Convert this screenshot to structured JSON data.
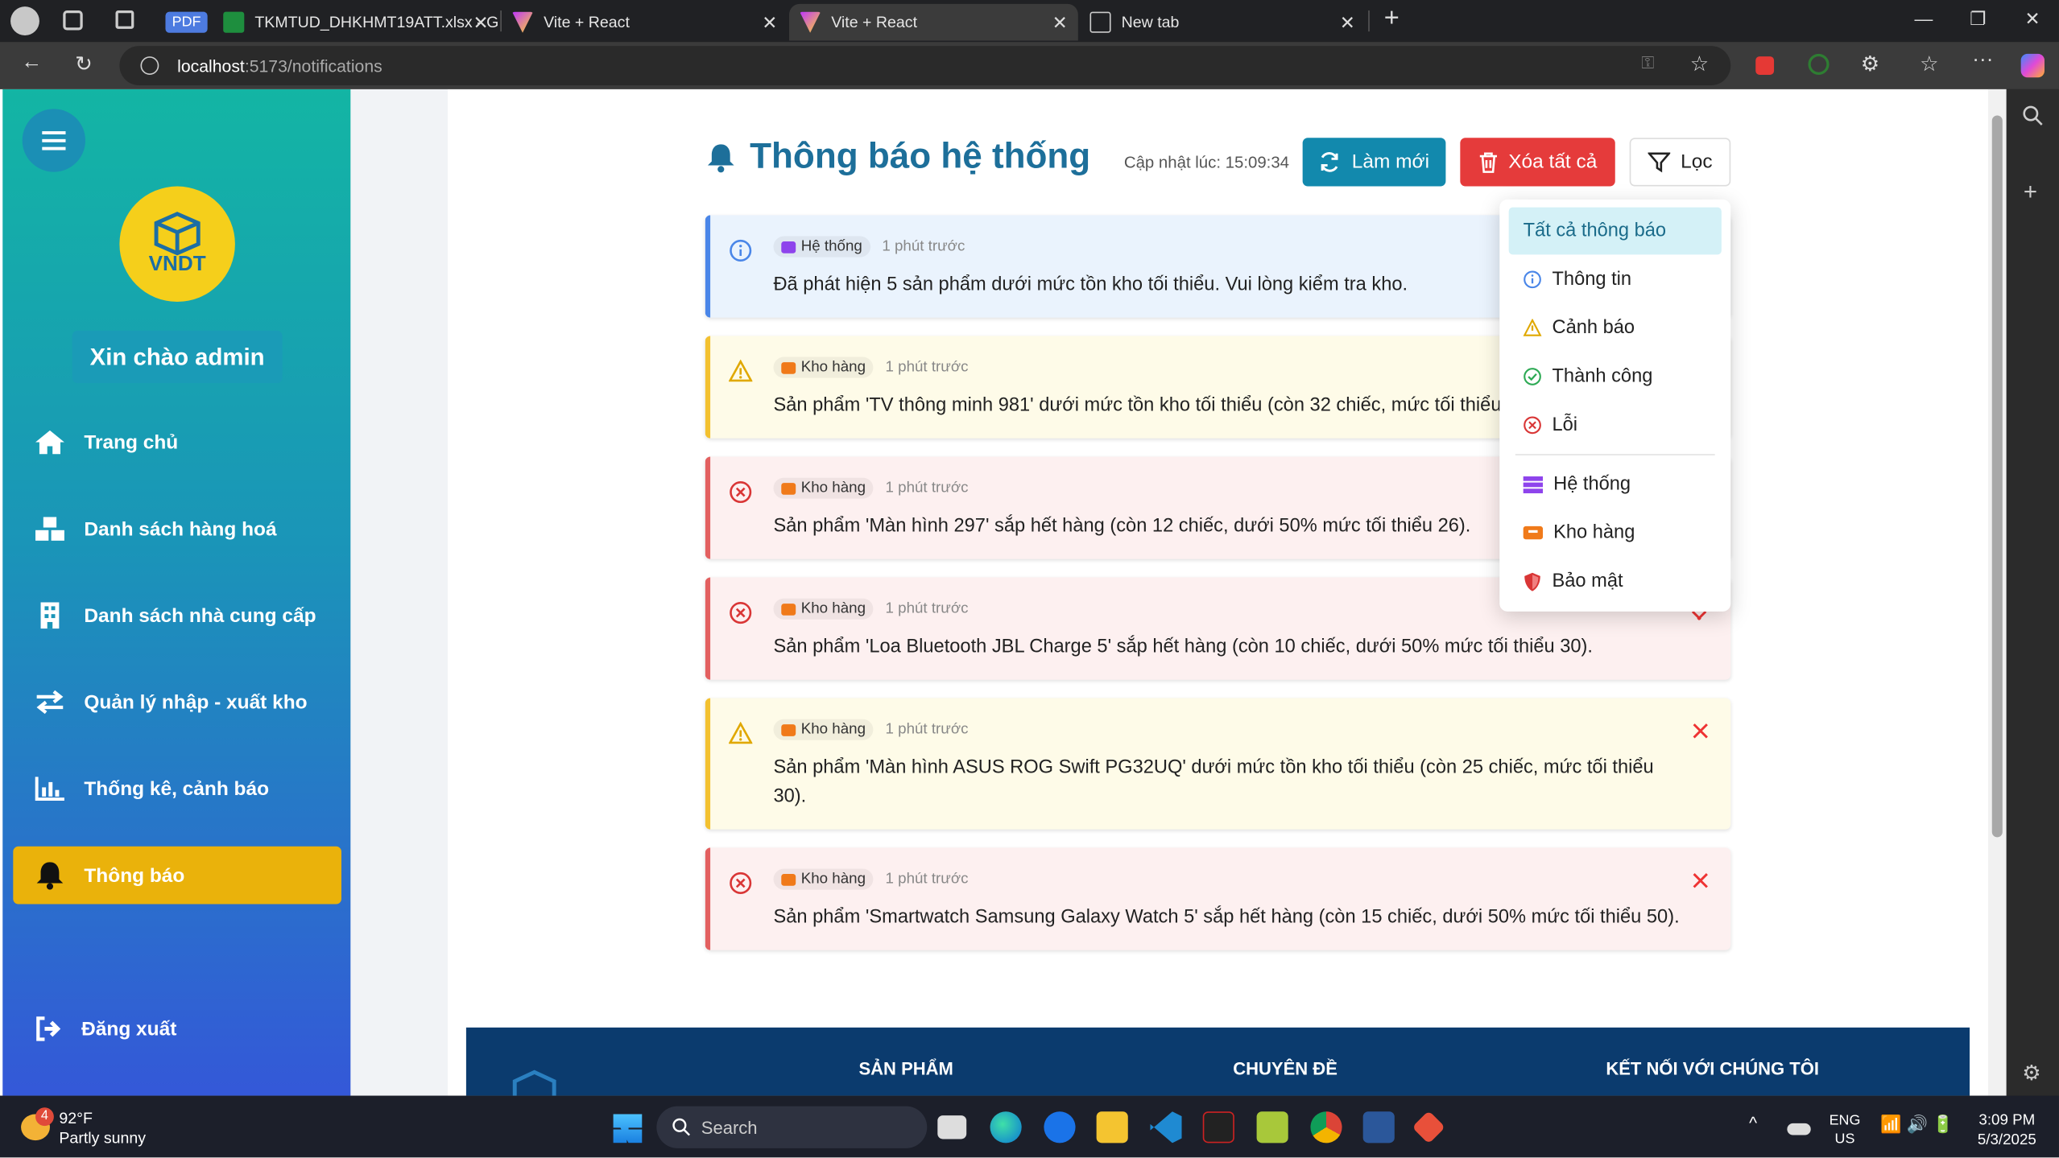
{
  "browser": {
    "tabs": [
      {
        "label": "",
        "icon": "account-icon"
      },
      {
        "label": "PDF",
        "icon": "pdf-icon"
      },
      {
        "label": "TKMTUD_DHKHMT19ATT.xlsx - G",
        "icon": "sheets-icon"
      },
      {
        "label": "Vite + React",
        "icon": "vite-icon"
      },
      {
        "label": "Vite + React",
        "icon": "vite-icon",
        "active": true
      },
      {
        "label": "New tab",
        "icon": "newtab-icon"
      }
    ],
    "url_host": "localhost",
    "url_path": ":5173/notifications"
  },
  "sidebar": {
    "logo_text": "VNDT",
    "greeting": "Xin chào  admin",
    "items": [
      {
        "label": "Trang chủ",
        "icon": "home-icon"
      },
      {
        "label": "Danh sách hàng hoá",
        "icon": "boxes-icon"
      },
      {
        "label": "Danh sách nhà cung cấp",
        "icon": "building-icon"
      },
      {
        "label": "Quản lý nhập - xuất kho",
        "icon": "arrows-icon"
      },
      {
        "label": "Thống kê, cảnh báo",
        "icon": "chart-icon"
      },
      {
        "label": "Thông báo",
        "icon": "bell-icon",
        "active": true
      }
    ],
    "logout": "Đăng xuất"
  },
  "header": {
    "title": "Thông báo hệ thống",
    "updated": "Cập nhật lúc: 15:09:34",
    "refresh": "Làm mới",
    "clear_all": "Xóa tất cả",
    "filter": "Lọc"
  },
  "notifications": [
    {
      "type": "info",
      "category": "Hệ thống",
      "time": "1 phút trước",
      "message": "Đã phát hiện 5 sản phẩm dưới mức tồn kho tối thiểu. Vui lòng kiểm tra kho."
    },
    {
      "type": "warning",
      "category": "Kho hàng",
      "time": "1 phút trước",
      "message": "Sản phẩm 'TV thông minh 981' dưới mức tồn kho tối thiểu (còn 32 chiếc, mức tối thiểu"
    },
    {
      "type": "error",
      "category": "Kho hàng",
      "time": "1 phút trước",
      "message": "Sản phẩm 'Màn hình 297' sắp hết hàng (còn 12 chiếc, dưới 50% mức tối thiểu 26)."
    },
    {
      "type": "error",
      "category": "Kho hàng",
      "time": "1 phút trước",
      "message": "Sản phẩm 'Loa Bluetooth JBL Charge 5' sắp hết hàng (còn 10 chiếc, dưới 50% mức tối thiểu 30)."
    },
    {
      "type": "warning",
      "category": "Kho hàng",
      "time": "1 phút trước",
      "message": "Sản phẩm 'Màn hình ASUS ROG Swift PG32UQ' dưới mức tồn kho tối thiểu (còn 25 chiếc, mức tối thiểu 30)."
    },
    {
      "type": "error",
      "category": "Kho hàng",
      "time": "1 phút trước",
      "message": "Sản phẩm 'Smartwatch Samsung Galaxy Watch 5' sắp hết hàng (còn 15 chiếc, dưới 50% mức tối thiểu 50)."
    }
  ],
  "filter_menu": {
    "items": [
      {
        "label": "Tất cả thông báo",
        "icon": "",
        "selected": true
      },
      {
        "label": "Thông tin",
        "icon": "info-icon"
      },
      {
        "label": "Cảnh báo",
        "icon": "warning-icon"
      },
      {
        "label": "Thành công",
        "icon": "check-circle-icon"
      },
      {
        "label": "Lỗi",
        "icon": "error-circle-icon"
      },
      {
        "label": "Hệ thống",
        "icon": "server-icon"
      },
      {
        "label": "Kho hàng",
        "icon": "warehouse-icon"
      },
      {
        "label": "Bảo mật",
        "icon": "shield-icon"
      }
    ]
  },
  "footer": {
    "col1": "SẢN PHẨM",
    "col2": "CHUYÊN ĐỀ",
    "col3": "KẾT NỐI VỚI CHÚNG TÔI"
  },
  "taskbar": {
    "weather_temp": "92°F",
    "weather_desc": "Partly sunny",
    "weather_badge": "4",
    "search": "Search",
    "lang1": "ENG",
    "lang2": "US",
    "time": "3:09 PM",
    "date": "5/3/2025"
  },
  "colors": {
    "info": "#4a86e8",
    "warning": "#f3c130",
    "error": "#e36060",
    "primary": "#1289ad",
    "danger": "#e53b3b",
    "sidebar_active": "#eab20b"
  }
}
